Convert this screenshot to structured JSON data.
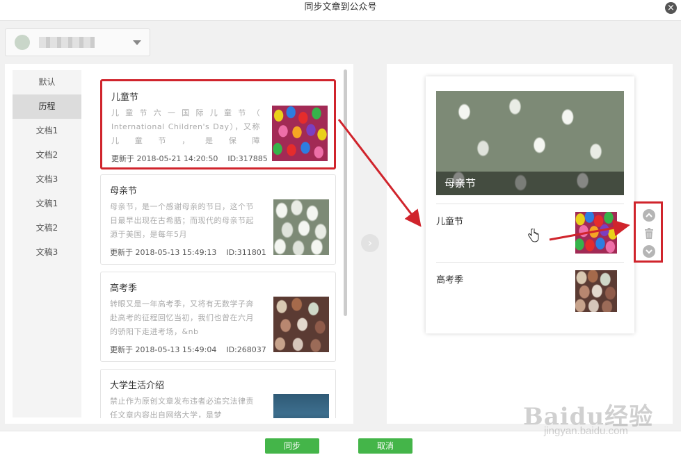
{
  "window": {
    "title": "同步文章到公众号",
    "close_icon": "×"
  },
  "account": {
    "name": "▪▪▪▪▪▪"
  },
  "categories": [
    {
      "label": "默认"
    },
    {
      "label": "历程"
    },
    {
      "label": "文档1"
    },
    {
      "label": "文档2"
    },
    {
      "label": "文档3"
    },
    {
      "label": "文稿1"
    },
    {
      "label": "文稿2"
    },
    {
      "label": "文稿3"
    }
  ],
  "active_category": "历程",
  "articles": [
    {
      "title": "儿童节",
      "digest": "儿 童 节 六 一 国 际 儿 童 节 （ International Children's Day），又称儿童节，是保障",
      "updated": "更新于 2018-05-21 14:20:50",
      "id": "ID:317885",
      "thumbnail": "colorful-eggs"
    },
    {
      "title": "母亲节",
      "digest": "母亲节，是一个感谢母亲的节日，这个节日最早出现在古希腊；而现代的母亲节起源于美国，是每年5月",
      "updated": "更新于 2018-05-13 15:49:13",
      "id": "ID:311801",
      "thumbnail": "white-tulips"
    },
    {
      "title": "高考季",
      "digest": "转眼又是一年高考季，又将有无数学子奔赴高考的征程回忆当初，我们也曾在六月的骄阳下走进考场，&nb",
      "updated": "更新于 2018-05-13 15:49:04",
      "id": "ID:268037",
      "thumbnail": "speckled-eggs"
    },
    {
      "title": "大学生活介绍",
      "digest": "禁止作为原创文章发布违者必追究法律责任文章内容出自网络大学，是梦",
      "updated": "",
      "id": "",
      "thumbnail": "water"
    }
  ],
  "preview": {
    "cover_title": "母亲节",
    "items": [
      {
        "title": "儿童节",
        "thumbnail": "colorful-eggs"
      },
      {
        "title": "高考季",
        "thumbnail": "speckled-eggs"
      }
    ]
  },
  "icons": {
    "transfer": "›",
    "move_up": "up-chevron-icon",
    "delete": "trash-icon",
    "move_down": "down-chevron-icon"
  },
  "footer": {
    "sync_label": "同步",
    "cancel_label": "取消"
  },
  "watermark": {
    "brand": "Baidu经验",
    "url": "jingyan.baidu.com"
  },
  "colors": {
    "accent_green": "#44b549",
    "highlight_red": "#d0242c"
  }
}
